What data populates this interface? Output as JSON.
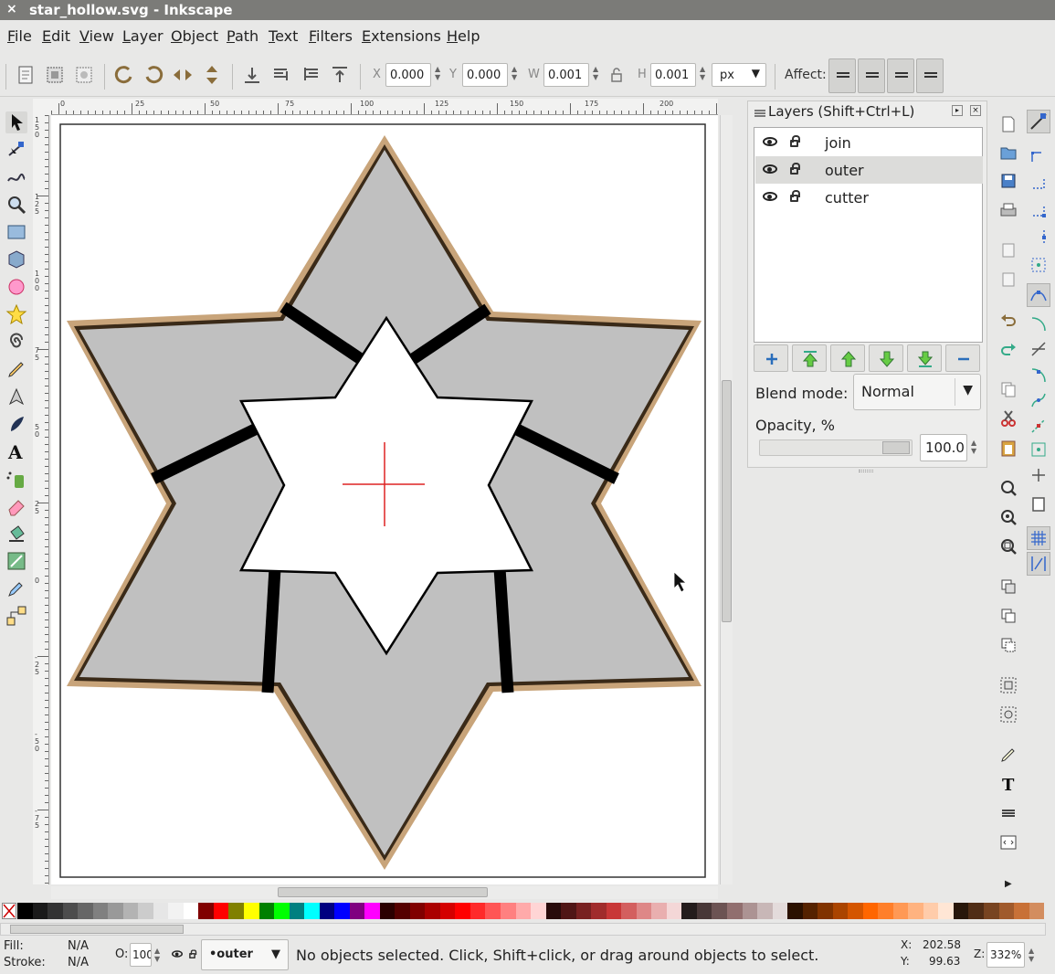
{
  "window": {
    "title": "star_hollow.svg - Inkscape",
    "close_glyph": "×"
  },
  "menu": [
    "File",
    "Edit",
    "View",
    "Layer",
    "Object",
    "Path",
    "Text",
    "Filters",
    "Extensions",
    "Help"
  ],
  "toolbar": {
    "x_label": "X",
    "x_value": "0.000",
    "y_label": "Y",
    "y_value": "0.000",
    "w_label": "W",
    "w_value": "0.001",
    "h_label": "H",
    "h_value": "0.001",
    "unit": "px",
    "affect_label": "Affect:"
  },
  "ruler_h_ticks": [
    "0",
    "25",
    "50",
    "75",
    "100",
    "125",
    "150",
    "175",
    "200"
  ],
  "ruler_v_ticks": [
    "1\n5\n0",
    "1\n2\n5",
    "1\n0\n0",
    "7\n5",
    "5\n0",
    "2\n5",
    "0",
    "-\n2\n5",
    "-\n5\n0",
    "-\n7\n5"
  ],
  "layers_panel": {
    "title": "Layers (Shift+Ctrl+L)",
    "layers": [
      {
        "name": "join",
        "selected": false
      },
      {
        "name": "outer",
        "selected": true
      },
      {
        "name": "cutter",
        "selected": false
      }
    ],
    "blend_label": "Blend mode:",
    "blend_value": "Normal",
    "opacity_label": "Opacity, %",
    "opacity_value": "100.0"
  },
  "palette_colors": [
    "#000000",
    "#1a1a1a",
    "#333333",
    "#4d4d4d",
    "#666666",
    "#808080",
    "#999999",
    "#b3b3b3",
    "#cccccc",
    "#e6e6e6",
    "#f2f2f2",
    "#ffffff",
    "#800000",
    "#ff0000",
    "#808000",
    "#ffff00",
    "#008000",
    "#00ff00",
    "#008080",
    "#00ffff",
    "#000080",
    "#0000ff",
    "#800080",
    "#ff00ff",
    "#2b0000",
    "#550000",
    "#800000",
    "#aa0000",
    "#d40000",
    "#ff0000",
    "#ff2a2a",
    "#ff5555",
    "#ff8080",
    "#ffaaaa",
    "#ffd5d5",
    "#280b0b",
    "#501616",
    "#782121",
    "#a02c2c",
    "#c83737",
    "#d35f5f",
    "#de8787",
    "#e9afaf",
    "#f4d7d7",
    "#241c1c",
    "#483737",
    "#6c5353",
    "#916f6f",
    "#ac9393",
    "#c8b7b7",
    "#e3dbdb",
    "#2b1100",
    "#552200",
    "#803300",
    "#aa4400",
    "#d45500",
    "#ff6600",
    "#ff7f2a",
    "#ff9955",
    "#ffb380",
    "#ffccaa",
    "#ffe6d5",
    "#28170b",
    "#502d16",
    "#784421",
    "#a05a2c",
    "#c87137",
    "#d38d5f"
  ],
  "status": {
    "fill_label": "Fill:",
    "fill_value": "N/A",
    "stroke_label": "Stroke:",
    "stroke_value": "N/A",
    "o_label": "O:",
    "o_value": "100",
    "layer_value": "•outer",
    "message": "No objects selected. Click, Shift+click, or drag around objects to select.",
    "x_label": "X:",
    "x_value": "202.58",
    "y_label": "Y:",
    "y_value": "99.63",
    "z_label": "Z:",
    "z_value": "332%"
  },
  "colors": {
    "star_fill": "#c0c0c0",
    "star_outline": "#c8a47a",
    "guide_cross": "#dd2222"
  }
}
